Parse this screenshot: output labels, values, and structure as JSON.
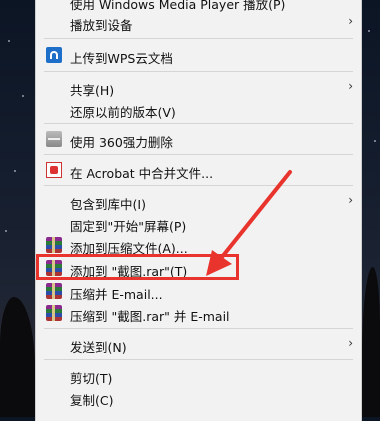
{
  "menu": {
    "items": [
      {
        "label": "使用 Windows Media Player 播放(P)"
      },
      {
        "label": "播放到设备"
      },
      {
        "label": "上传到WPS云文档"
      },
      {
        "label": "共享(H)"
      },
      {
        "label": "还原以前的版本(V)"
      },
      {
        "label": "使用 360强力删除"
      },
      {
        "label": "在 Acrobat 中合并文件..."
      },
      {
        "label": "包含到库中(I)"
      },
      {
        "label": "固定到\"开始\"屏幕(P)"
      },
      {
        "label": "添加到压缩文件(A)..."
      },
      {
        "label": "添加到 \"截图.rar\"(T)"
      },
      {
        "label": "压缩并 E-mail..."
      },
      {
        "label": "压缩到 \"截图.rar\" 并 E-mail"
      },
      {
        "label": "发送到(N)"
      },
      {
        "label": "剪切(T)"
      },
      {
        "label": "复制(C)"
      }
    ],
    "submenu_arrow": "›"
  },
  "colors": {
    "menu_bg": "#f2f2f2",
    "highlight": "#e8342d",
    "wallpaper": "#141d2d"
  },
  "icons": {
    "wps": "wps-cloud-icon",
    "erase": "360-shredder-icon",
    "acrobat": "acrobat-icon",
    "rar": "winrar-icon"
  }
}
